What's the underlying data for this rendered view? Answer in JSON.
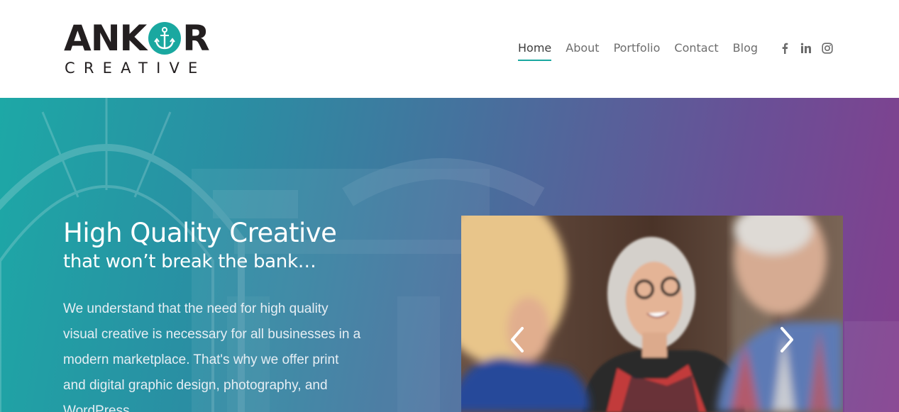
{
  "brand": {
    "logo_word_left": "ANK",
    "logo_word_right": "R",
    "logo_sub": "CREATIVE",
    "accent_color": "#1aa8a0"
  },
  "nav": {
    "items": [
      {
        "label": "Home",
        "active": true
      },
      {
        "label": "About",
        "active": false
      },
      {
        "label": "Portfolio",
        "active": false
      },
      {
        "label": "Contact",
        "active": false
      },
      {
        "label": "Blog",
        "active": false
      }
    ]
  },
  "social": {
    "items": [
      {
        "icon": "facebook-icon",
        "glyph": "f"
      },
      {
        "icon": "linkedin-icon",
        "glyph": "in"
      },
      {
        "icon": "instagram-icon",
        "glyph": ""
      }
    ]
  },
  "hero": {
    "title": "High Quality Creative",
    "subtitle": "that won’t break the bank…",
    "body": "We understand that the need for high quality visual creative is necessary for all businesses in a modern marketplace. That's why we offer print and digital graphic design, photography, and WordPress",
    "gradient_start": "#1da8a6",
    "gradient_end": "#833f8e"
  },
  "slider": {
    "prev_icon": "chevron-left-icon",
    "next_icon": "chevron-right-icon"
  }
}
